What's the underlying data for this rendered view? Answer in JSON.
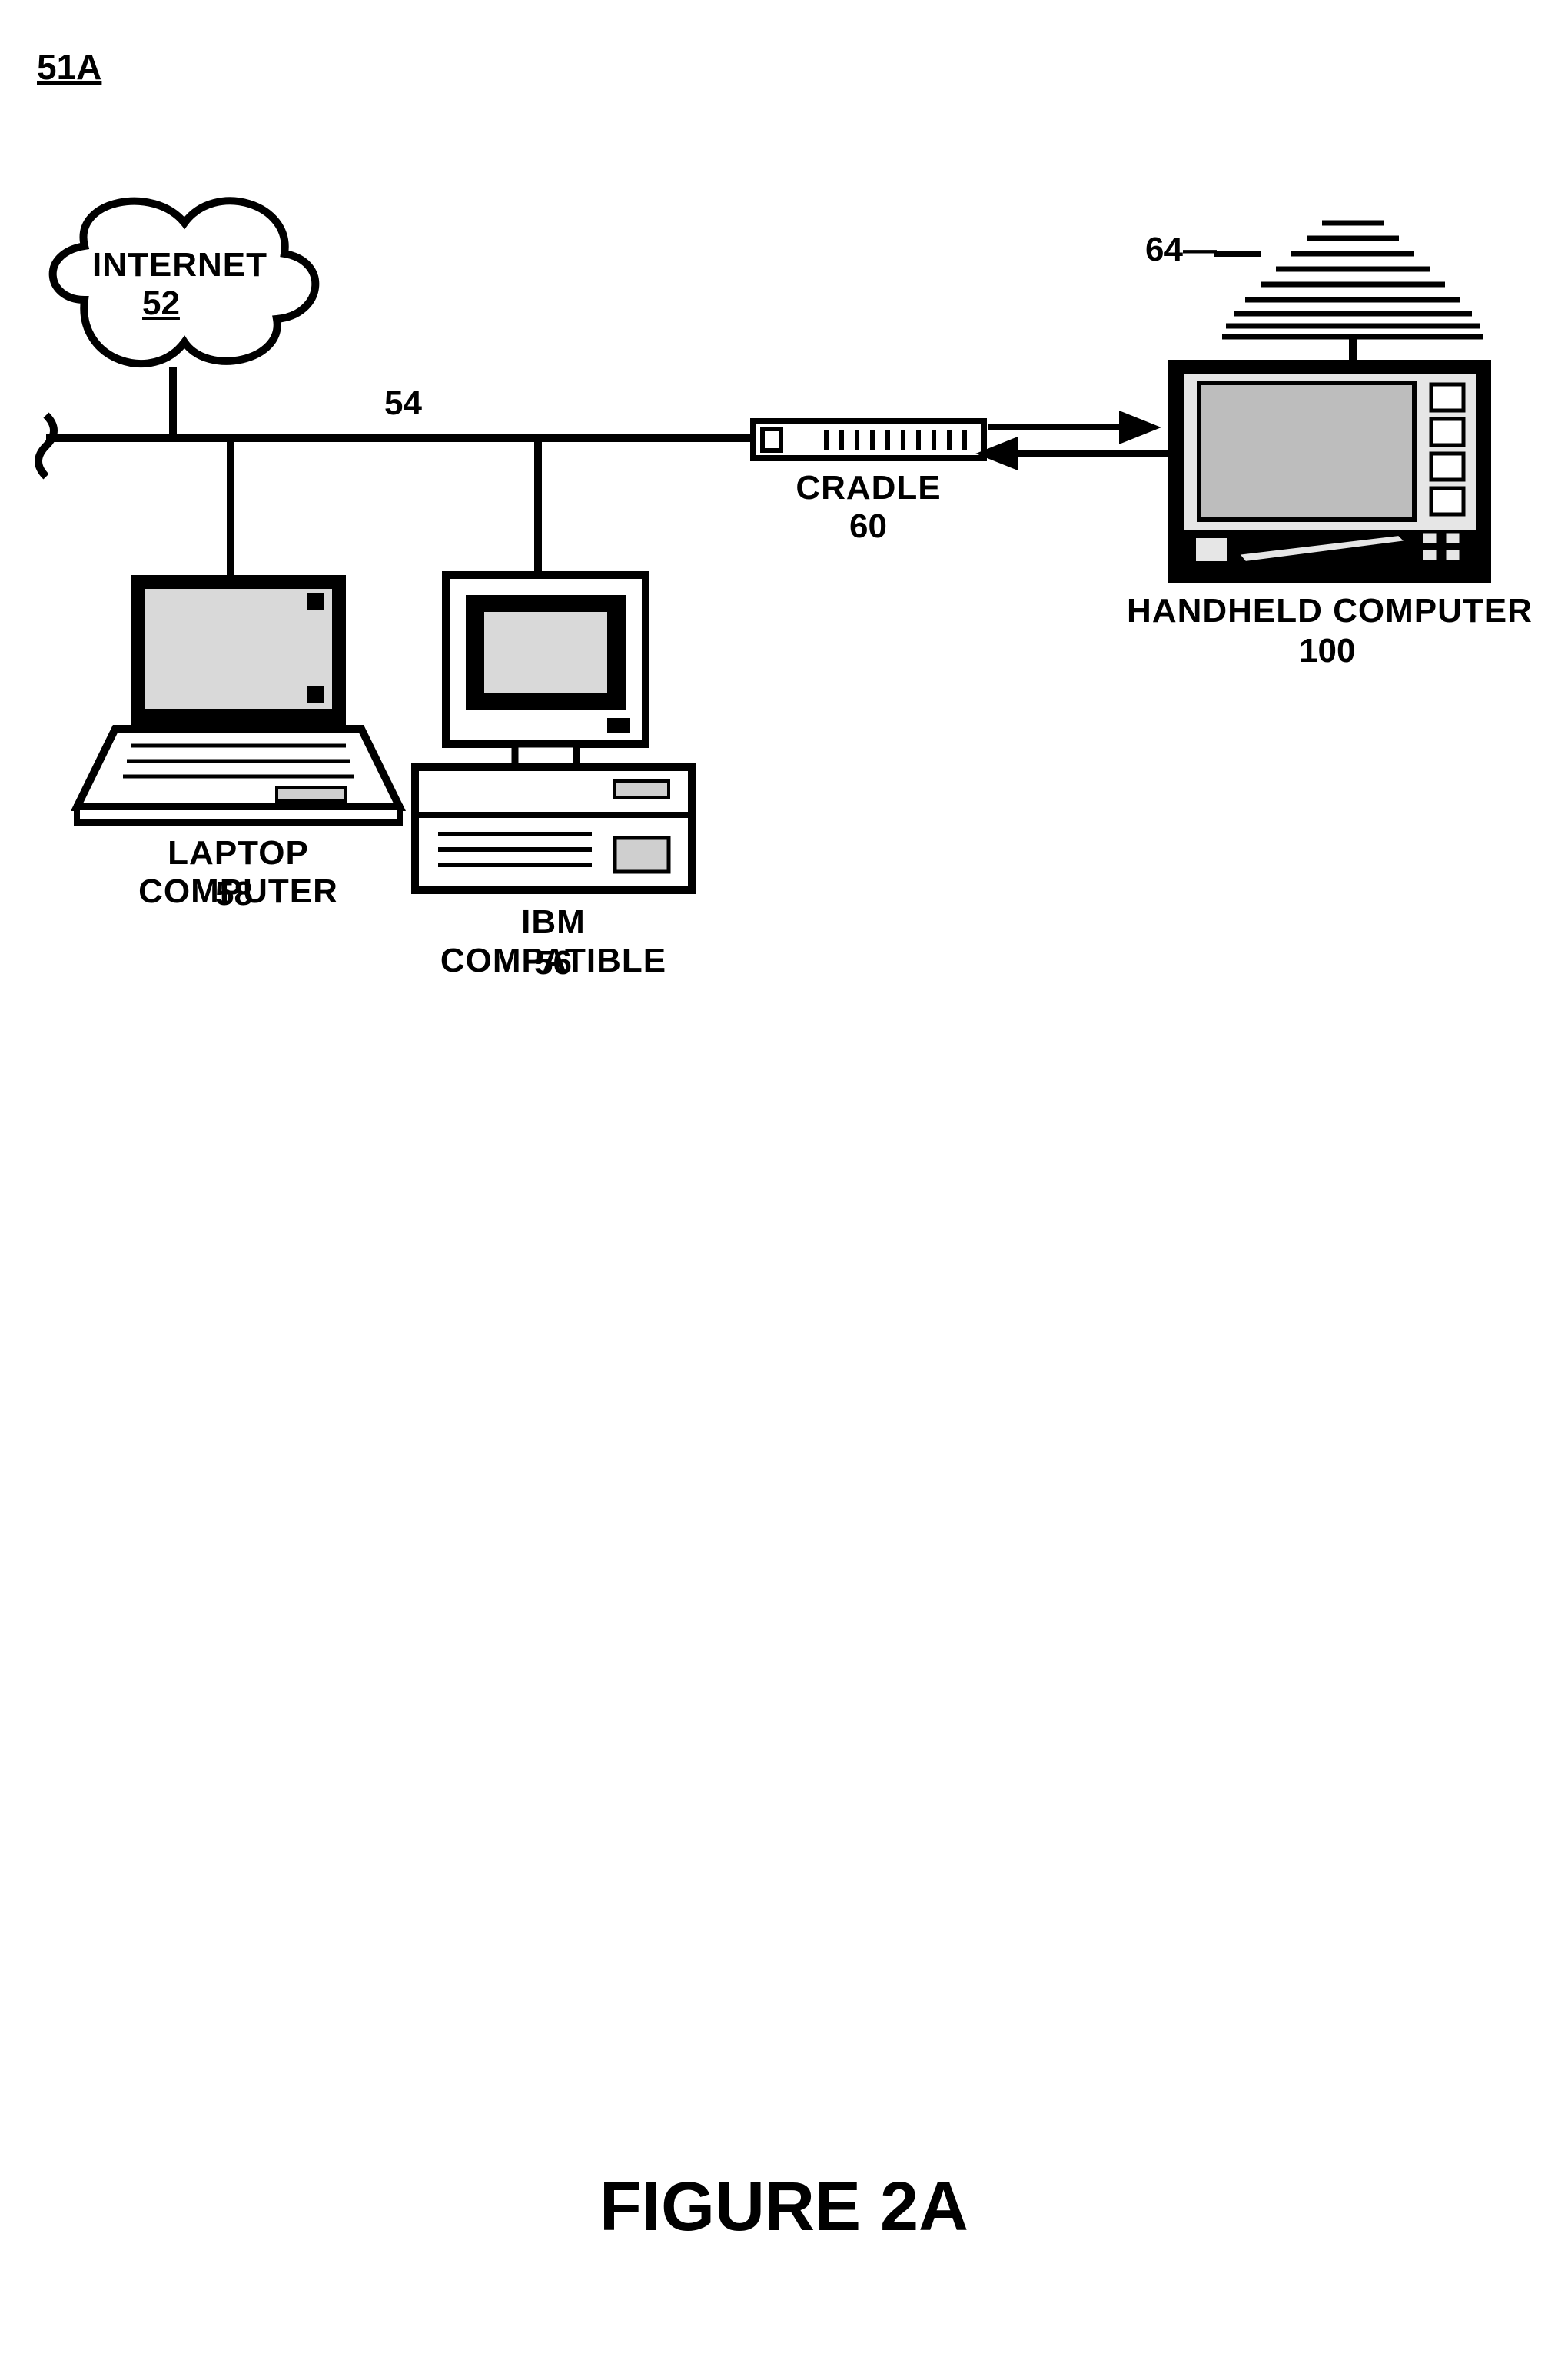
{
  "figure": {
    "id_label": "51A",
    "caption": "FIGURE 2A"
  },
  "nodes": {
    "internet": {
      "label": "INTERNET",
      "ref": "52"
    },
    "bus_ref": "54",
    "laptop": {
      "label": "LAPTOP COMPUTER",
      "ref": "58"
    },
    "pc": {
      "label": "IBM COMPATIBLE",
      "ref": "56"
    },
    "cradle": {
      "label": "CRADLE",
      "ref": "60"
    },
    "handheld": {
      "label": "HANDHELD COMPUTER",
      "ref": "100"
    },
    "antenna_ref": "64"
  }
}
